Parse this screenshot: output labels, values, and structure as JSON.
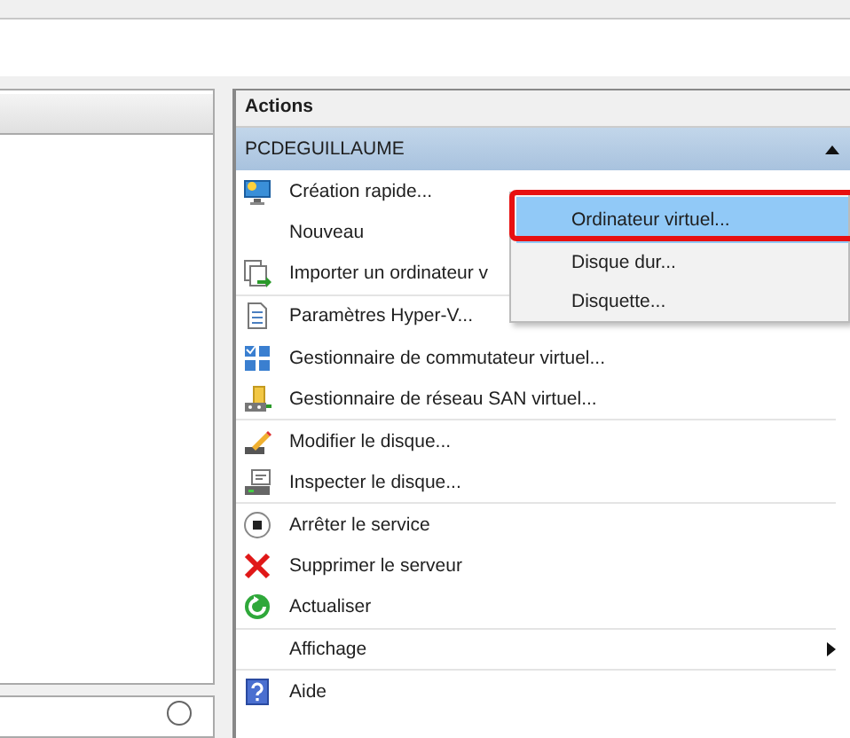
{
  "actions_pane": {
    "title": "Actions",
    "group": {
      "title": "PCDEGUILLAUME",
      "expanded": true
    },
    "items": [
      {
        "label": "Création rapide...",
        "separator_after": false
      },
      {
        "label": "Nouveau",
        "separator_after": false
      },
      {
        "label": "Importer un ordinateur v",
        "separator_after": true
      },
      {
        "label": "Paramètres Hyper-V...",
        "separator_after": false
      },
      {
        "label": "Gestionnaire de commutateur virtuel...",
        "separator_after": false
      },
      {
        "label": "Gestionnaire de réseau SAN virtuel...",
        "separator_after": true
      },
      {
        "label": "Modifier le disque...",
        "separator_after": false
      },
      {
        "label": "Inspecter le disque...",
        "separator_after": true
      },
      {
        "label": "Arrêter le service",
        "separator_after": false
      },
      {
        "label": "Supprimer le serveur",
        "separator_after": false
      },
      {
        "label": "Actualiser",
        "separator_after": true
      },
      {
        "label": "Affichage",
        "separator_after": true,
        "submenu": true
      },
      {
        "label": "Aide",
        "separator_after": false
      }
    ]
  },
  "submenu": {
    "items": [
      {
        "label": "Ordinateur virtuel...",
        "selected": true
      },
      {
        "label": "Disque dur...",
        "selected": false
      },
      {
        "label": "Disquette...",
        "selected": false
      }
    ]
  }
}
